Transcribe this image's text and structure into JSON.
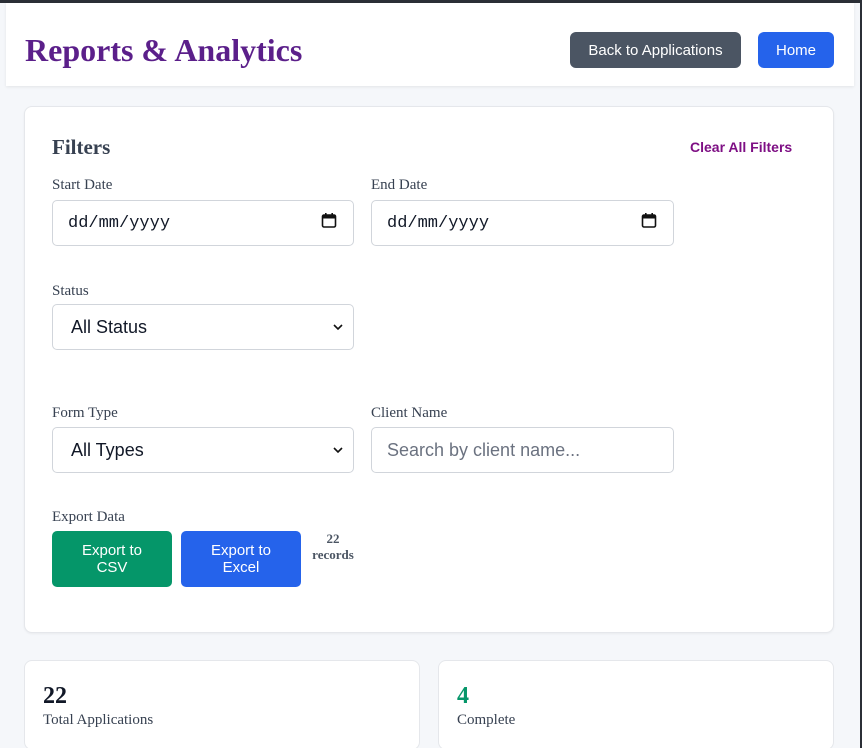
{
  "header": {
    "title": "Reports & Analytics",
    "back_label": "Back to Applications",
    "home_label": "Home",
    "title_color": "#5b1f8a"
  },
  "filters": {
    "title": "Filters",
    "clear_label": "Clear All Filters",
    "start_date": {
      "label": "Start Date",
      "value": "dd/mm/yyyy",
      "icon": "calendar-icon"
    },
    "end_date": {
      "label": "End Date",
      "value": "dd/mm/yyyy",
      "icon": "calendar-icon"
    },
    "status": {
      "label": "Status",
      "value": "All Status",
      "icon": "chevron-down-icon"
    },
    "form_type": {
      "label": "Form Type",
      "value": "All Types",
      "icon": "chevron-down-icon"
    },
    "client_name": {
      "label": "Client Name",
      "placeholder": "Search by client name..."
    },
    "export": {
      "label": "Export Data",
      "csv_label": "Export to CSV",
      "excel_label": "Export to Excel",
      "records_count": "22",
      "records_label": "records"
    }
  },
  "stats": [
    {
      "value": "22",
      "label": "Total Applications",
      "color": "#111827"
    },
    {
      "value": "4",
      "label": "Complete",
      "color": "#059669"
    }
  ]
}
